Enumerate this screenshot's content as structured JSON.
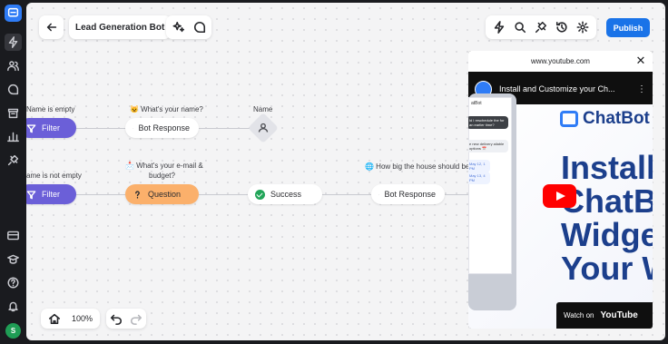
{
  "sidebar": {
    "avatar_letter": "S"
  },
  "header": {
    "bot_name": "Lead Generation Bot",
    "publish_label": "Publish"
  },
  "flow": {
    "row1": {
      "filter_label": "Name is empty",
      "filter_node": "Filter",
      "response_label": "😺 What's your name?",
      "response_node": "Bot Response",
      "attribute_label": "Name"
    },
    "row2": {
      "filter_label": "ame is not empty",
      "filter_node": "Filter",
      "question_label_1": "📩 What's your e-mail &",
      "question_label_2": "budget?",
      "question_node": "Question",
      "success_node": "Success",
      "response_label": "🌐 How big the house should be",
      "response_node": "Bot Response"
    }
  },
  "video": {
    "url": "www.youtube.com",
    "title": "Install and Customize your Ch...",
    "logo_text": "ChatBot",
    "big_text": [
      "Install",
      "ChatBo",
      "Widge",
      "Your W"
    ],
    "watch_on": "Watch on",
    "youtube": "YouTube",
    "phone": {
      "header": "atBot",
      "bubble1": "ld I reschedule the for an earlier time?",
      "bubble2": "e new delivery ailable options 📅",
      "chip1": "May 12, 1 PM",
      "chip2": "May 13, 4 PM"
    }
  },
  "bottom": {
    "zoom": "100%"
  },
  "colors": {
    "publish": "#1a73e8",
    "filter": "#6b5fd8",
    "question": "#fbb06b",
    "success": "#22a559"
  }
}
